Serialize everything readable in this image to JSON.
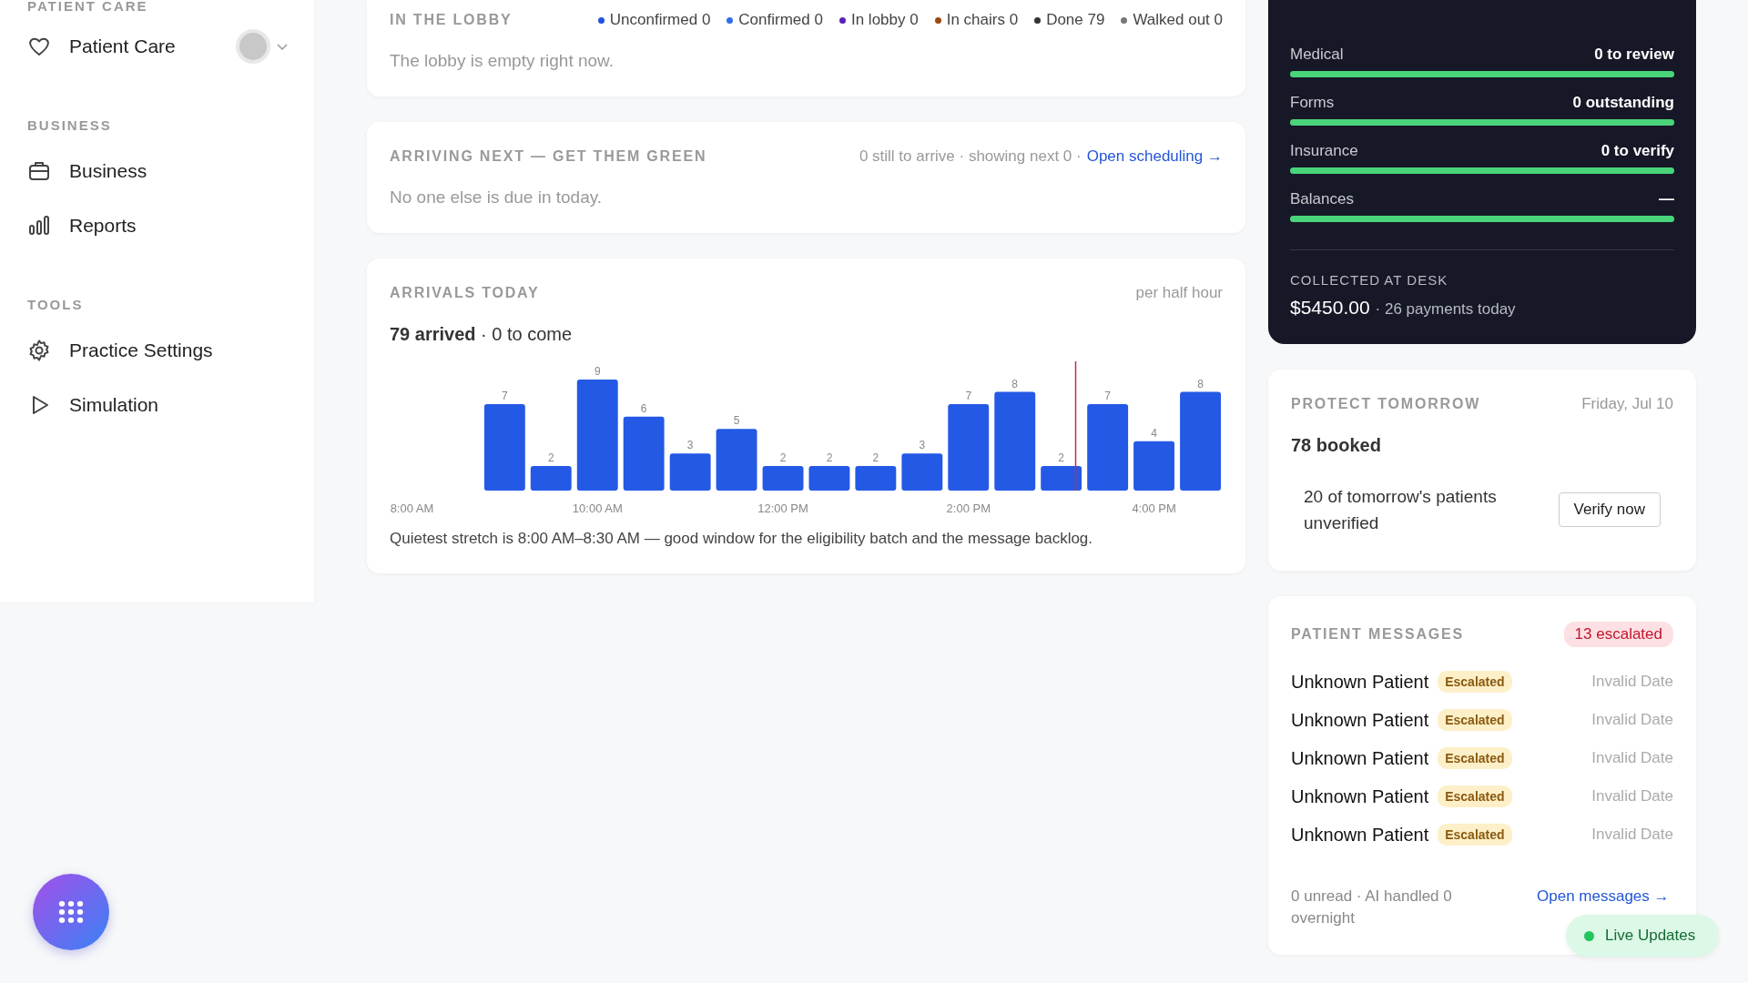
{
  "sidebar": {
    "sections": [
      {
        "heading": "PATIENT CARE",
        "items": [
          {
            "label": "Patient Care",
            "kind": "expandable"
          }
        ]
      },
      {
        "heading": "BUSINESS",
        "items": [
          {
            "label": "Business",
            "kind": "link"
          },
          {
            "label": "Reports",
            "kind": "link"
          }
        ]
      },
      {
        "heading": "TOOLS",
        "items": [
          {
            "label": "Practice Settings",
            "kind": "link"
          },
          {
            "label": "Simulation",
            "kind": "link"
          }
        ]
      }
    ]
  },
  "lobby": {
    "title": "IN THE LOBBY",
    "legend": [
      {
        "label": "Unconfirmed 0",
        "color": "#2450e0"
      },
      {
        "label": "Confirmed 0",
        "color": "#2f6fe8"
      },
      {
        "label": "In lobby 0",
        "color": "#5b21b6"
      },
      {
        "label": "In chairs 0",
        "color": "#9a4a10"
      },
      {
        "label": "Done 79",
        "color": "#333333"
      },
      {
        "label": "Walked out 0",
        "color": "#777777"
      }
    ],
    "message": "The lobby is empty right now."
  },
  "arriving": {
    "title": "ARRIVING NEXT — GET THEM GREEN",
    "summary": "0 still to arrive · showing next 0 ·",
    "link": "Open scheduling →",
    "message": "No one else is due in today."
  },
  "arrivals": {
    "title": "ARRIVALS TODAY",
    "unit": "per half hour",
    "headline": "**79 arrived** · 0 to come",
    "chart_data": {
      "type": "bar",
      "categories": [
        "8:00 AM",
        null,
        null,
        null,
        "10:00 AM",
        null,
        null,
        null,
        "12:00 PM",
        null,
        null,
        null,
        "2:00 PM",
        null,
        null,
        null,
        "4:00 PM",
        null
      ],
      "values": [
        0,
        0,
        7,
        2,
        9,
        6,
        3,
        5,
        2,
        2,
        2,
        3,
        7,
        8,
        2,
        7,
        4,
        8
      ],
      "value_labels": [
        null,
        null,
        "7",
        "2",
        "9",
        "6",
        "3",
        "5",
        "2",
        "2",
        "2",
        "3",
        "7",
        "8",
        "2",
        "7",
        "4",
        "8"
      ]
    },
    "note": "Quietest stretch is 8:00 AM–8:30 AM — good window for the eligibility batch and the message backlog."
  },
  "checklist": {
    "rows": [
      {
        "label": "Medical",
        "value": "0 to review",
        "level": 1
      },
      {
        "label": "Forms",
        "value": "0 outstanding",
        "level": 1
      },
      {
        "label": "Insurance",
        "value": "0 to verify",
        "level": 1
      },
      {
        "label": "Balances",
        "value": "—",
        "level": 1
      }
    ],
    "collected_label": "COLLECTED AT DESK",
    "amount": "$5450.00",
    "detail": "· 26 payments today"
  },
  "tomorrow": {
    "title": "PROTECT TOMORROW",
    "date": "Friday, Jul 10",
    "booked": "78 booked",
    "alert": "20 of tomorrow's patients unverified",
    "button": "Verify now"
  },
  "messages": {
    "title": "PATIENT MESSAGES",
    "badge": "13 escalated",
    "rows": [
      {
        "name": "Unknown Patient",
        "status": "Escalated",
        "date": "Invalid Date"
      },
      {
        "name": "Unknown Patient",
        "status": "Escalated",
        "date": "Invalid Date"
      },
      {
        "name": "Unknown Patient",
        "status": "Escalated",
        "date": "Invalid Date"
      },
      {
        "name": "Unknown Patient",
        "status": "Escalated",
        "date": "Invalid Date"
      },
      {
        "name": "Unknown Patient",
        "status": "Escalated",
        "date": "Invalid Date"
      }
    ],
    "footer": "0 unread · AI handled 0 overnight",
    "link": "Open messages →"
  },
  "live": {
    "label": "Live Updates",
    "on": true
  }
}
